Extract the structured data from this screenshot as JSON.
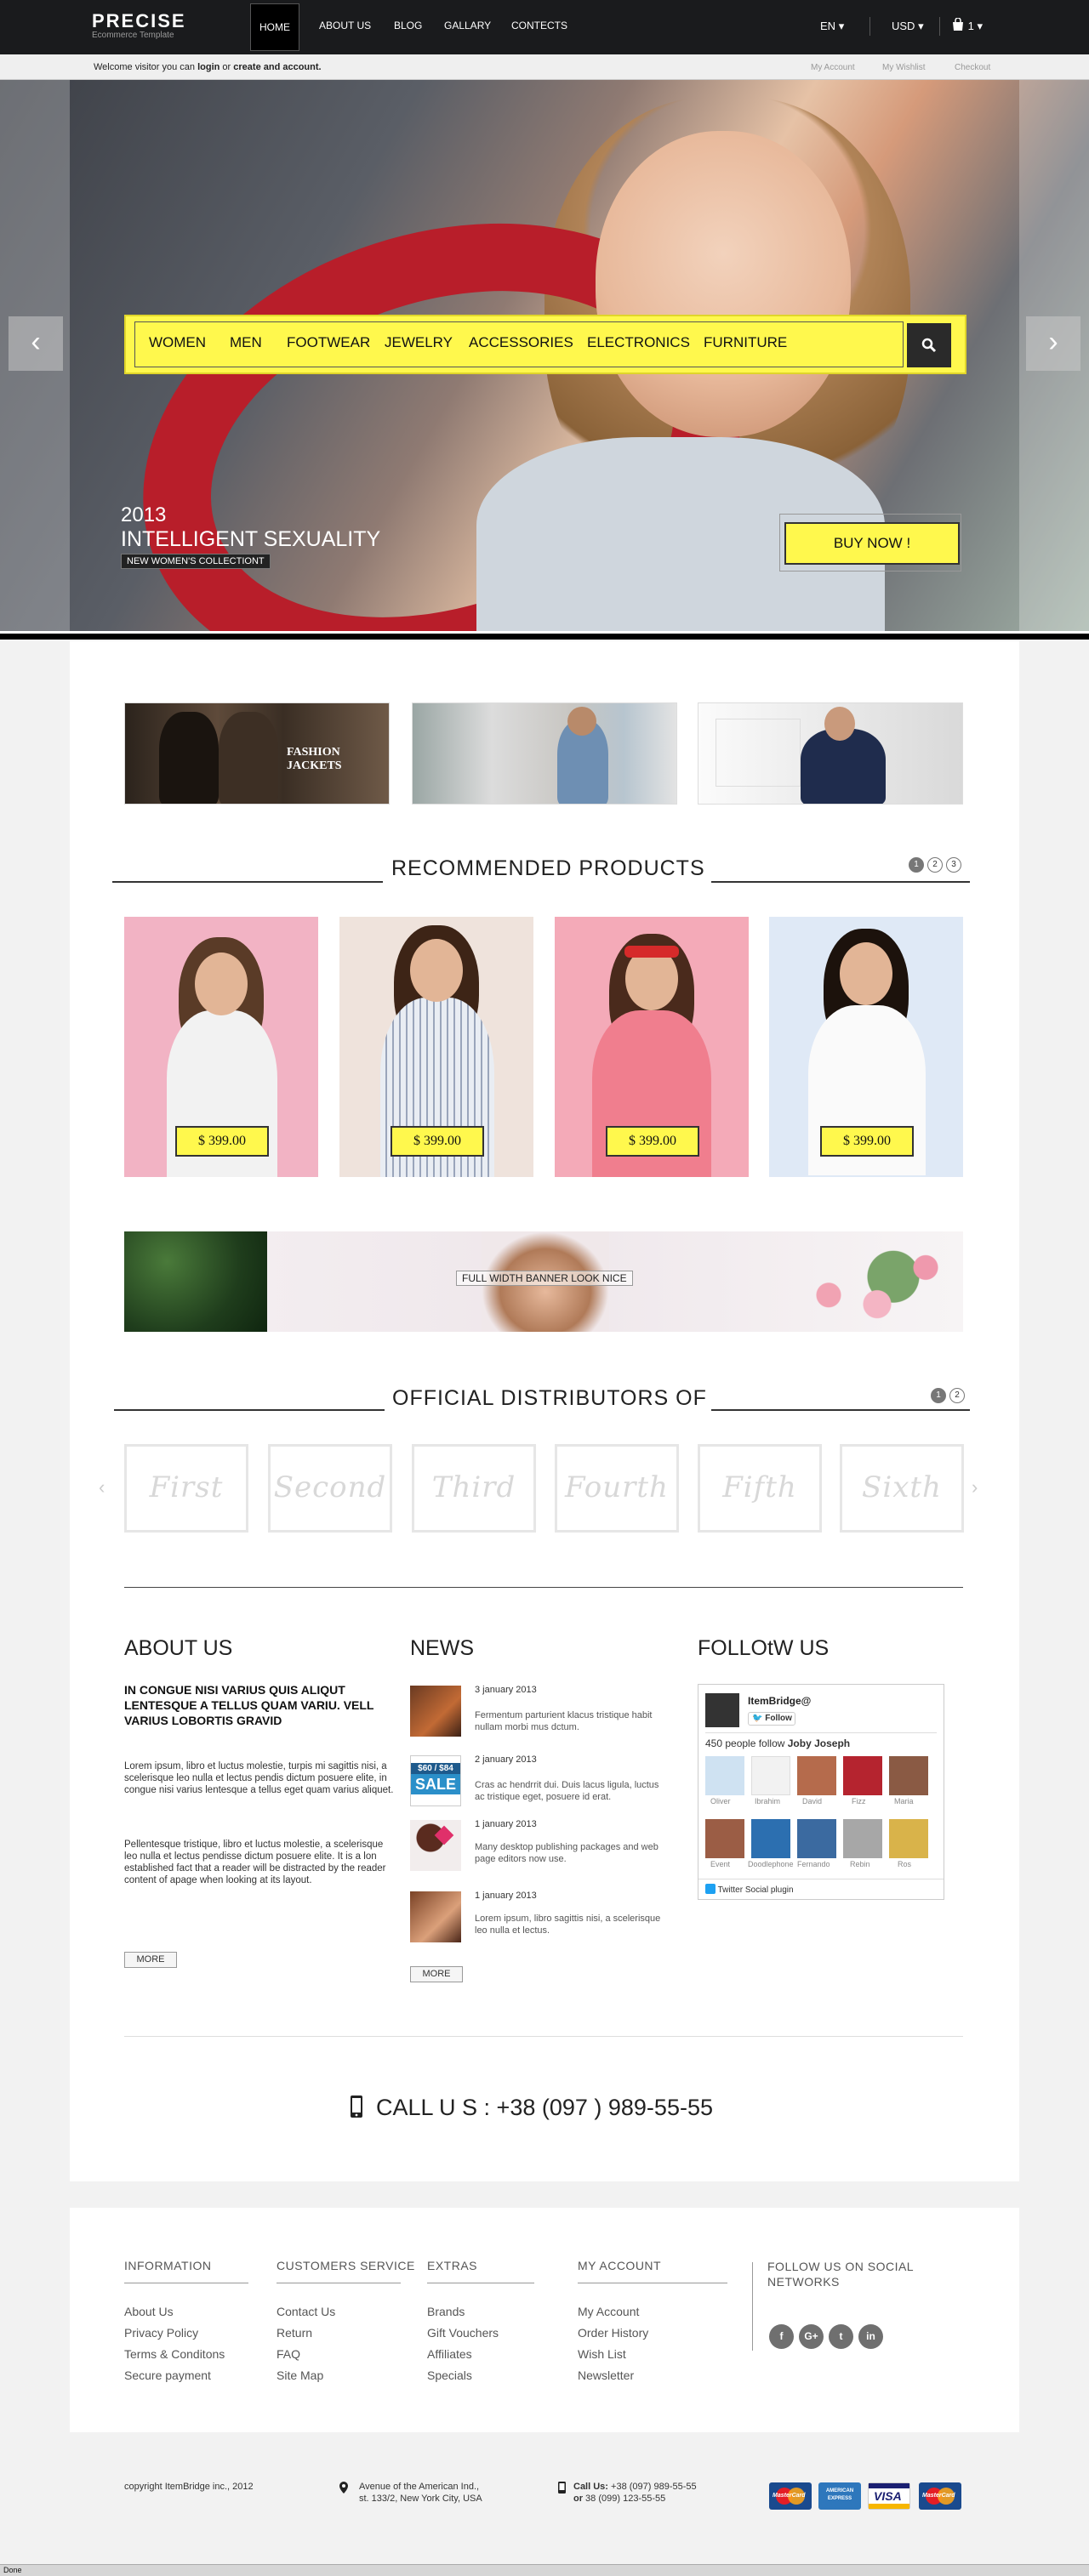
{
  "header": {
    "logo": "PRECISE",
    "logo_sub": "Ecommerce Template",
    "nav": [
      "HOME",
      "ABOUT US",
      "BLOG",
      "GALLARY",
      "CONTECTS"
    ],
    "language": "EN",
    "currency": "USD",
    "cart_count": "1"
  },
  "subbar": {
    "welcome_pre": "Welcome visitor you can ",
    "login": "login",
    "or": " or ",
    "create": "create and account.",
    "links": [
      "My Account",
      "My Wishlist",
      "Checkout"
    ]
  },
  "hero": {
    "menu": [
      "WOMEN",
      "MEN",
      "FOOTWEAR",
      "JEWELRY",
      "ACCESSORIES",
      "ELECTRONICS",
      "FURNITURE"
    ],
    "year": "2013",
    "title": "INTELLIGENT SEXUALITY",
    "subtitle": "NEW WOMEN'S COLLECTIONT",
    "buy": "BUY NOW !"
  },
  "banners": {
    "fashion_jackets": "FASHION JACKETS"
  },
  "recommended": {
    "title": "RECOMMENDED PRODUCTS",
    "pages": [
      "1",
      "2",
      "3"
    ],
    "active_page": "1",
    "prices": [
      "$ 399.00",
      "$ 399.00",
      "$ 399.00",
      "$ 399.00"
    ]
  },
  "wide_banner": {
    "text": "FULL WIDTH BANNER LOOK NICE"
  },
  "distributors": {
    "title": "OFFICIAL DISTRIBUTORS OF",
    "pages": [
      "1",
      "2"
    ],
    "active_page": "1",
    "names": [
      "First",
      "Second",
      "Third",
      "Fourth",
      "Fifth",
      "Sixth"
    ]
  },
  "about": {
    "title": "ABOUT US",
    "bold": "IN CONGUE NISI VARIUS QUIS ALIQUT LENTESQUE A TELLUS QUAM VARIU. VELL VARIUS LOBORTIS GRAVID",
    "p1": "Lorem ipsum, libro et luctus molestie, turpis mi sagittis nisi, a scelerisque leo nulla et lectus pendis dictum posuere elite, in congue nisi varius lentesque a tellus eget quam varius aliquet.",
    "p2": "Pellentesque tristique, libro et luctus molestie, a scelerisque leo nulla et lectus pendisse dictum posuere elite. It is a lon established fact that a reader will  be distracted by the reader content of apage when looking at its layout.",
    "more": "MORE"
  },
  "news": {
    "title": "NEWS",
    "items": [
      {
        "date": "3 january 2013",
        "text": "Fermentum parturient klacus tristique habit nullam morbi mus dctum."
      },
      {
        "date": "2 january 2013",
        "text": "Cras ac hendrrit dui. Duis lacus ligula, luctus ac tristique eget, posuere id erat."
      },
      {
        "date": "1 january 2013",
        "text": "Many desktop publishing packages and web page editors now use."
      },
      {
        "date": "1 january 2013",
        "text": "Lorem ipsum, libro sagittis nisi, a scelerisque leo nulla et lectus."
      }
    ],
    "sale_badge_top": "$60 / $84",
    "sale_badge": "SALE",
    "more": "MORE"
  },
  "follow": {
    "title": "FOLLOtW US",
    "account": "ItemBridge@",
    "follow_btn": "Follow",
    "people": "450 people follow ",
    "person": "Joby Joseph",
    "names": [
      "Oliver",
      "Ibrahim",
      "David",
      "Fizz",
      "Maria",
      "Event",
      "Doodlephone",
      "Fernando",
      "Rebin",
      "Ros"
    ],
    "plugin": "Twitter Social plugin"
  },
  "call": {
    "text": "CALL U S : +38  (097 ) 989-55-55"
  },
  "footer": {
    "columns": [
      {
        "title": "INFORMATION",
        "links": [
          "About Us",
          "Privacy Policy",
          "Terms & Conditons",
          "Secure payment"
        ]
      },
      {
        "title": "CUSTOMERS SERVICE",
        "links": [
          "Contact Us",
          "Return",
          "FAQ",
          "Site Map"
        ]
      },
      {
        "title": "EXTRAS",
        "links": [
          "Brands",
          "Gift Vouchers",
          "Affiliates",
          "Specials"
        ]
      },
      {
        "title": "MY ACCOUNT",
        "links": [
          "My Account",
          "Order History",
          "Wish List",
          "Newsletter"
        ]
      }
    ],
    "social_title": "FOLLOW US ON SOCIAL NETWORKS",
    "social_icons": [
      "f",
      "G+",
      "t",
      "in"
    ]
  },
  "bottom": {
    "copyright": "copyright ItemBridge inc., 2012",
    "address1": "Avenue of the American Ind.,",
    "address2": "st. 133/2, New York City, USA",
    "call_label": "Call Us:",
    "phone1": " +38 (097) 989-55-55",
    "or": "or",
    "phone2": " 38 (099) 123-55-55",
    "cards": [
      "MasterCard",
      "AMERICAN EXPRESS",
      "VISA",
      "MasterCard"
    ]
  },
  "status": "Done",
  "colors": {
    "accent": "#fff84d",
    "dark": "#1a1b1d",
    "twitter": "#1da1f2"
  }
}
